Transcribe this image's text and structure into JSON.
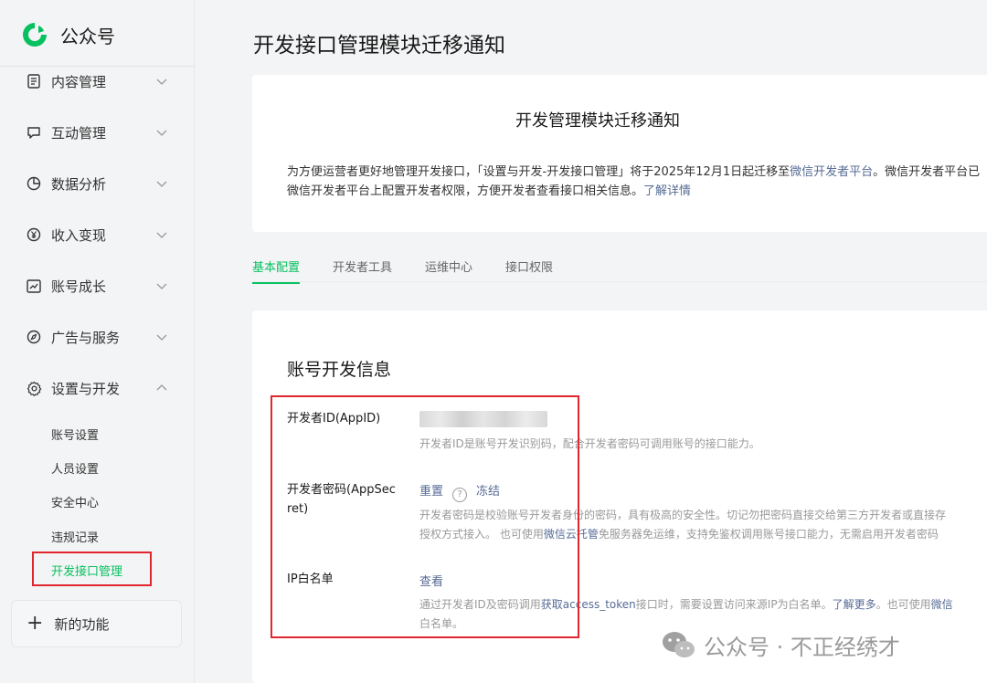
{
  "app": {
    "name": "公众号",
    "page_title": "开发接口管理模块迁移通知"
  },
  "sidebar": {
    "items": [
      {
        "label": "内容管理",
        "icon": "document-icon"
      },
      {
        "label": "互动管理",
        "icon": "chat-icon"
      },
      {
        "label": "数据分析",
        "icon": "pie-chart-icon"
      },
      {
        "label": "收入变现",
        "icon": "yen-icon"
      },
      {
        "label": "账号成长",
        "icon": "trend-icon"
      },
      {
        "label": "广告与服务",
        "icon": "compass-icon"
      },
      {
        "label": "设置与开发",
        "icon": "gear-icon"
      }
    ],
    "sub_items": [
      "账号设置",
      "人员设置",
      "安全中心",
      "违规记录",
      "开发接口管理"
    ],
    "new_feature": "新的功能"
  },
  "notice": {
    "title": "开发管理模块迁移通知",
    "line1_a": "为方便运营者更好地管理开发接口，「设置与开发-开发接口管理」将于2025年12月1日起迁移至",
    "line1_link": "微信开发者平台",
    "line1_b": "。微信开发者平台已",
    "line2_a": "微信开发者平台上配置开发者权限，方便开发者查看接口相关信息。",
    "line2_link": "了解详情"
  },
  "tabs": [
    "基本配置",
    "开发者工具",
    "运维中心",
    "接口权限"
  ],
  "account_info": {
    "section_title": "账号开发信息",
    "appid_label": "开发者ID(AppID)",
    "appid_desc": "开发者ID是账号开发识别码，配合开发者密码可调用账号的接口能力。",
    "secret_label_1": "开发者密码(AppSec",
    "secret_label_2": "ret)",
    "secret_reset": "重置",
    "secret_freeze": "冻结",
    "secret_desc1": "开发者密码是校验账号开发者身份的密码，具有极高的安全性。切记勿把密码直接交给第三方开发者或直接存",
    "secret_desc2_a": "授权方式接入。 也可使用",
    "secret_desc2_link": "微信云托管",
    "secret_desc2_b": "免服务器免运维，支持免鉴权调用账号接口能力，无需启用开发者密码",
    "ip_label": "IP白名单",
    "ip_view": "查看",
    "ip_desc1_a": "通过开发者ID及密码调用",
    "ip_desc1_link1": "获取access_token",
    "ip_desc1_b": "接口时，需要设置访问来源IP为白名单。",
    "ip_desc1_link2": "了解更多",
    "ip_desc1_c": "。也可使用",
    "ip_desc1_link3": "微信",
    "ip_desc2": "白名单。"
  },
  "watermark": "公众号 · 不正经绣才",
  "colors": {
    "accent": "#07c160",
    "link": "#576b95",
    "highlight_box": "#e0262e"
  }
}
